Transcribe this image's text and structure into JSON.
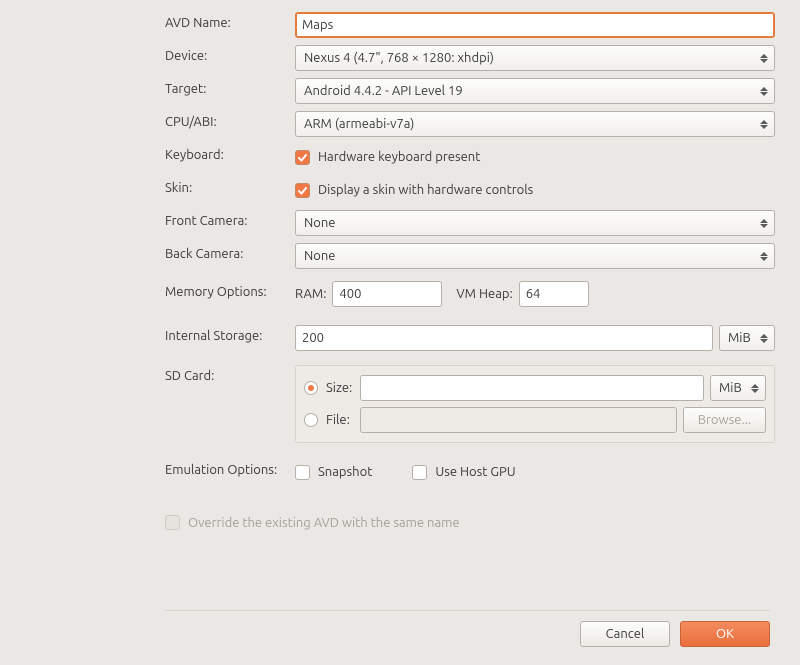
{
  "labels": {
    "avd_name": "AVD Name:",
    "device": "Device:",
    "target": "Target:",
    "cpu_abi": "CPU/ABI:",
    "keyboard": "Keyboard:",
    "skin": "Skin:",
    "front_camera": "Front Camera:",
    "back_camera": "Back Camera:",
    "memory_options": "Memory Options:",
    "internal_storage": "Internal Storage:",
    "sd_card": "SD Card:",
    "emulation_options": "Emulation Options:"
  },
  "fields": {
    "avd_name": "Maps",
    "device": "Nexus 4 (4.7\", 768 × 1280: xhdpi)",
    "target": "Android 4.4.2 - API Level 19",
    "cpu_abi": "ARM (armeabi-v7a)",
    "keyboard_label": "Hardware keyboard present",
    "skin_label": "Display a skin with hardware controls",
    "front_camera": "None",
    "back_camera": "None",
    "ram_label": "RAM:",
    "ram_value": "400",
    "vmheap_label": "VM Heap:",
    "vmheap_value": "64",
    "internal_storage_value": "200",
    "internal_storage_unit": "MiB",
    "sd_size_label": "Size:",
    "sd_size_value": "",
    "sd_size_unit": "MiB",
    "sd_file_label": "File:",
    "sd_file_value": "",
    "browse_label": "Browse...",
    "snapshot_label": "Snapshot",
    "use_host_gpu_label": "Use Host GPU",
    "override_label": "Override the existing AVD with the same name"
  },
  "buttons": {
    "cancel": "Cancel",
    "ok": "OK"
  }
}
